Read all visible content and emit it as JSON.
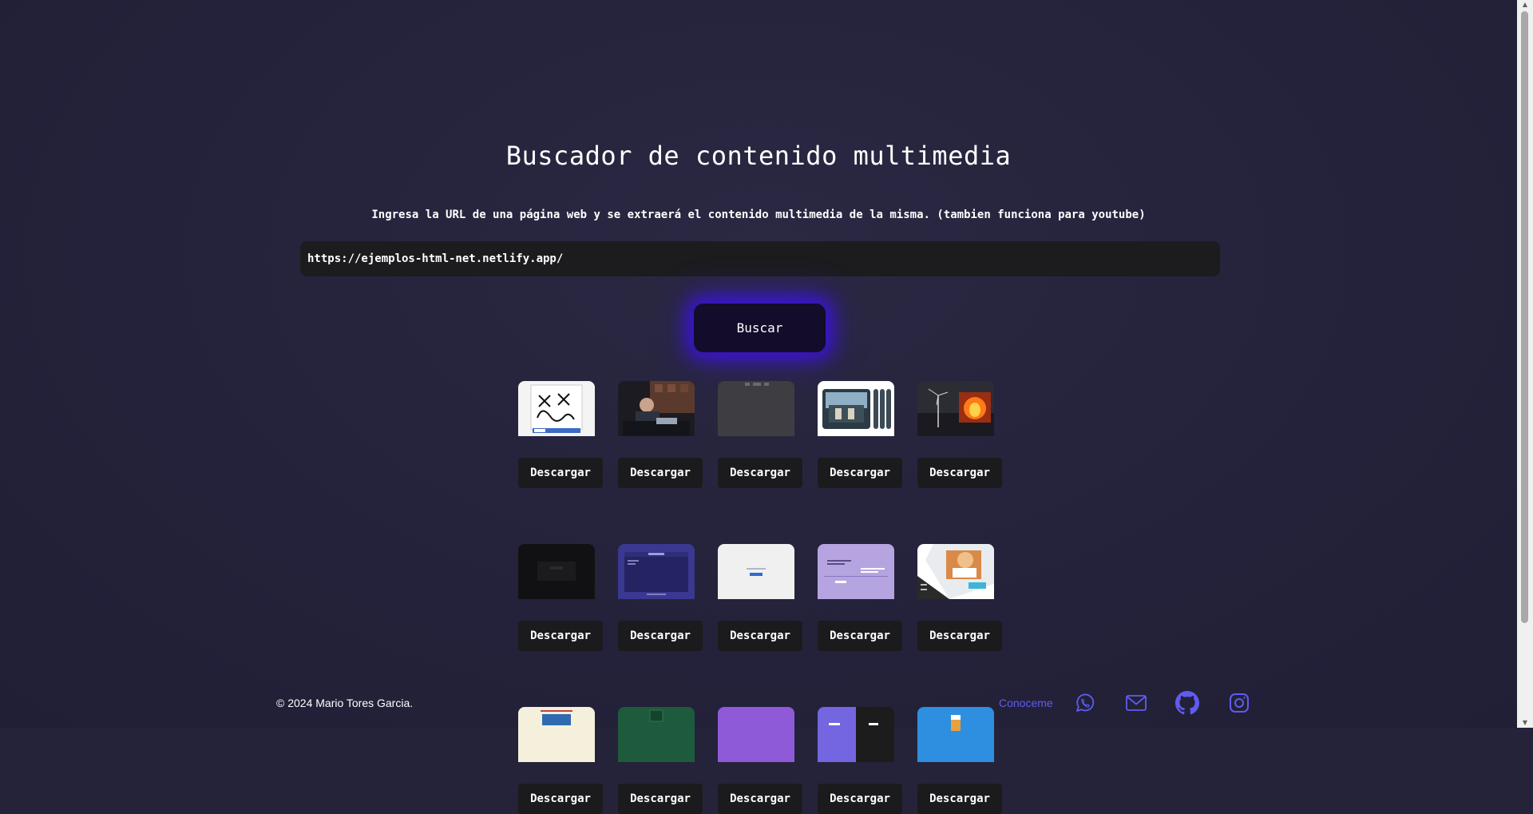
{
  "page": {
    "title": "Buscador de contenido multimedia",
    "subtitle": "Ingresa la URL de una página web y se extraerá el contenido multimedia de la misma. (tambien funciona para youtube)"
  },
  "search": {
    "value": "https://ejemplos-html-net.netlify.app/",
    "button_label": "Buscar"
  },
  "results": {
    "download_label": "Descargar",
    "items": [
      {
        "thumb": "drawing-app"
      },
      {
        "thumb": "dark-photo-desk"
      },
      {
        "thumb": "gray-page"
      },
      {
        "thumb": "building-gallery"
      },
      {
        "thumb": "windmill-fire"
      },
      {
        "thumb": "dark-page"
      },
      {
        "thumb": "purple-dashboard"
      },
      {
        "thumb": "light-form"
      },
      {
        "thumb": "lavender-page"
      },
      {
        "thumb": "dog-photo-site"
      },
      {
        "thumb": "cream-page"
      },
      {
        "thumb": "green-page"
      },
      {
        "thumb": "violet-page"
      },
      {
        "thumb": "play-split"
      },
      {
        "thumb": "blue-page"
      }
    ]
  },
  "footer": {
    "copyright": "© 2024 Mario Tores Garcia.",
    "conoceme": "Conoceme",
    "icons": [
      "whatsapp-icon",
      "mail-icon",
      "github-icon",
      "instagram-icon"
    ]
  },
  "colors": {
    "background": "#25233a",
    "accent": "#5f5cf0",
    "button_glow": "#3c0feb",
    "input_bg": "#1c1c1f"
  }
}
